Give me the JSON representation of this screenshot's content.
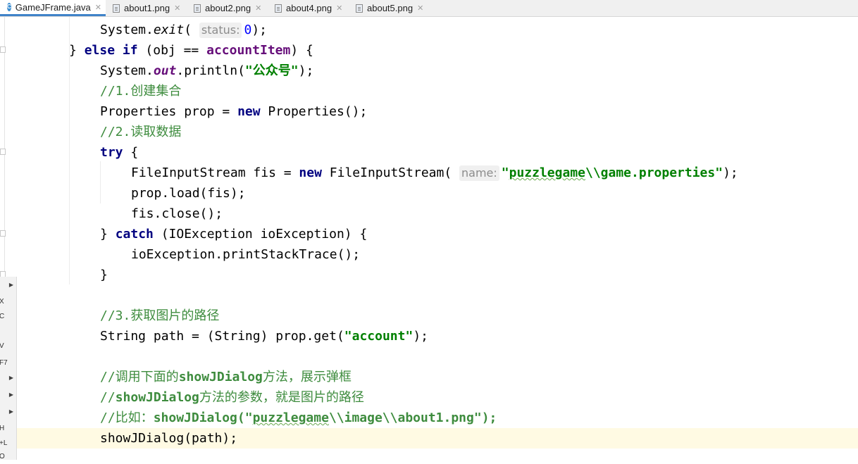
{
  "tabs": [
    {
      "label": "GameJFrame.java",
      "icon": "java-class-icon",
      "active": true
    },
    {
      "label": "about1.png",
      "icon": "image-file-icon",
      "active": false
    },
    {
      "label": "about2.png",
      "icon": "image-file-icon",
      "active": false
    },
    {
      "label": "about4.png",
      "icon": "image-file-icon",
      "active": false
    },
    {
      "label": "about5.png",
      "icon": "image-file-icon",
      "active": false
    }
  ],
  "tab_close_glyph": "✕",
  "java_icon_letter": "C",
  "side_labels": [
    "X",
    "C",
    "V",
    "F7",
    "H",
    "+L",
    "O"
  ],
  "colors": {
    "keyword": "#000080",
    "field": "#660e7a",
    "string": "#008000",
    "number": "#0000ff",
    "comment": "#3e8c3e",
    "current_line": "#fffae3",
    "active_tab_underline": "#4083c9"
  },
  "code": {
    "l1": {
      "a": "System.",
      "b": "exit",
      "c": "( ",
      "hint": "status:",
      "d": " ",
      "num": "0",
      "e": ");"
    },
    "l2": {
      "a": "} ",
      "kw1": "else",
      "b": " ",
      "kw2": "if",
      "c": " (obj == ",
      "fld": "accountItem",
      "d": ") {"
    },
    "l3": {
      "a": "System.",
      "fld": "out",
      "b": ".println(",
      "str": "\"公众号\"",
      "c": ");"
    },
    "l4": {
      "cmt": "//1.创建集合"
    },
    "l5": {
      "a": "Properties prop = ",
      "kw": "new",
      "b": " Properties();"
    },
    "l6": {
      "cmt": "//2.读取数据"
    },
    "l7": {
      "kw": "try",
      "a": " {"
    },
    "l8": {
      "a": "FileInputStream fis = ",
      "kw": "new",
      "b": " FileInputStream( ",
      "hint": "name:",
      "str1": "\"",
      "str_sq": "puzzlegame",
      "str2": "\\\\game.properties\"",
      "c": ");"
    },
    "l9": {
      "a": "prop.load(fis);"
    },
    "l10": {
      "a": "fis.close();"
    },
    "l11": {
      "a": "} ",
      "kw": "catch",
      "b": " (IOException ioException) {"
    },
    "l12": {
      "a": "ioException.printStackTrace();"
    },
    "l13": {
      "a": "}"
    },
    "l14": {
      "a": ""
    },
    "l15": {
      "cmt": "//3.获取图片的路径"
    },
    "l16": {
      "a": "String path = (String) prop.get(",
      "str": "\"account\"",
      "b": ");"
    },
    "l17": {
      "a": ""
    },
    "l18": {
      "cmt1": "//调用下面的",
      "cmt_b": "showJDialog",
      "cmt2": "方法，展示弹框"
    },
    "l19": {
      "cmt1": "//",
      "cmt_b": "showJDialog",
      "cmt2": "方法的参数，就是图片的路径"
    },
    "l20": {
      "cmt1": "//比如：",
      "cmt_b1": "showJDialog(\"",
      "cmt_sq": "puzzlegame",
      "cmt_b2": "\\\\image\\\\about1.png\");"
    },
    "l21": {
      "a": "showJDialog(path);"
    }
  }
}
